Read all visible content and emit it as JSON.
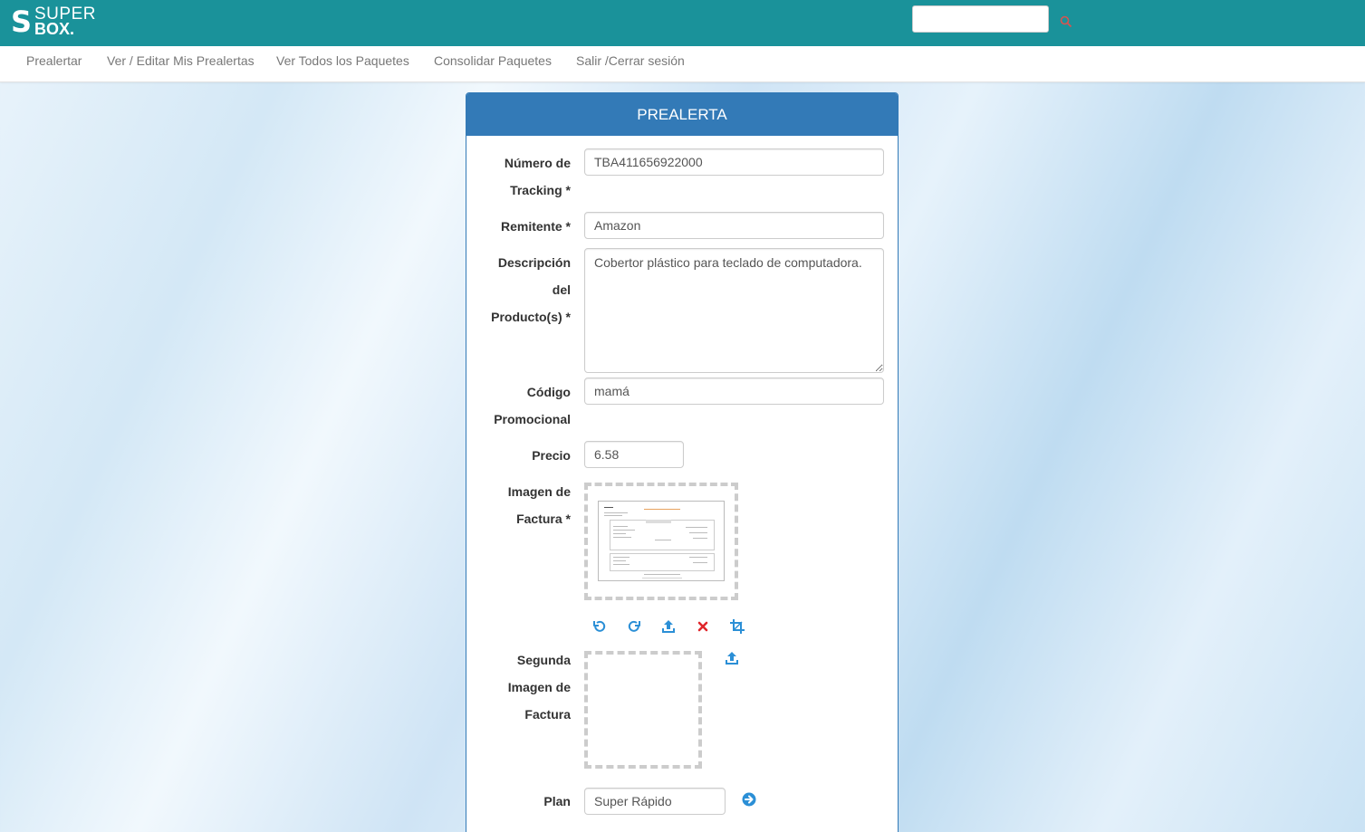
{
  "header": {
    "logo_letter": "S",
    "logo_super": "SUPER",
    "logo_box": "BOX.",
    "search": {
      "value": "",
      "placeholder": ""
    },
    "colors": {
      "bar": "#1a929a"
    }
  },
  "nav": {
    "items": [
      {
        "label": "Prealertar"
      },
      {
        "label": "Ver / Editar Mis Prealertas"
      },
      {
        "label": "Ver Todos los Paquetes"
      },
      {
        "label": "Consolidar Paquetes"
      },
      {
        "label": "Salir /Cerrar sesión"
      }
    ]
  },
  "form": {
    "title": "PREALERTA",
    "tracking": {
      "label_line1": "Número de",
      "label_line2": "Tracking *",
      "value": "TBA411656922000"
    },
    "sender": {
      "label": "Remitente *",
      "value": "Amazon"
    },
    "description": {
      "label_line1": "Descripción",
      "label_line2": "del",
      "label_line3": "Producto(s) *",
      "value": "Cobertor plástico para teclado de computadora."
    },
    "promo": {
      "label_line1": "Código",
      "label_line2": "Promocional",
      "value": "mamá"
    },
    "price": {
      "label": "Precio",
      "value": "6.58"
    },
    "invoice_image": {
      "label_line1": "Imagen de",
      "label_line2": "Factura *"
    },
    "second_invoice_image": {
      "label_line1": "Segunda",
      "label_line2": "Imagen de",
      "label_line3": "Factura"
    },
    "plan": {
      "label": "Plan",
      "value": "Super Rápido"
    },
    "icons": [
      "rotate-left-icon",
      "rotate-right-icon",
      "upload-icon",
      "delete-icon",
      "crop-icon",
      "upload-icon",
      "arrow-right-circle-icon"
    ],
    "colors": {
      "heading": "#337ab7",
      "icon_blue": "#2b8fd6",
      "icon_red": "#e0262b"
    }
  }
}
